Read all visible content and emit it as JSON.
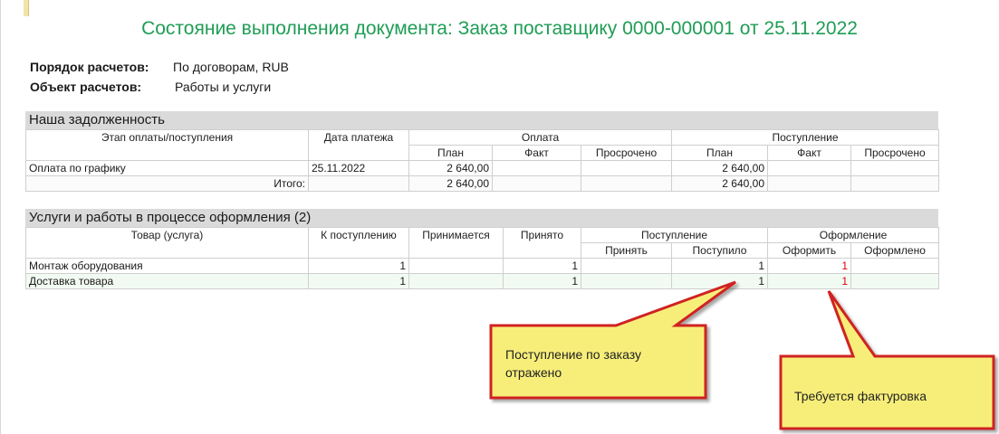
{
  "title": "Состояние выполнения документа: Заказ поставщику 0000-000001 от 25.11.2022",
  "info": [
    {
      "label": "Порядок расчетов:",
      "value": "По договорам, RUB"
    },
    {
      "label": "Объект расчетов:",
      "value": "Работы и услуги"
    }
  ],
  "debt_section": {
    "title": "Наша задолженность",
    "headers": {
      "stage": "Этап оплаты/поступления",
      "date": "Дата платежа",
      "payment": "Оплата",
      "receipt": "Поступление",
      "plan": "План",
      "fact": "Факт",
      "overdue": "Просрочено"
    },
    "rows": [
      {
        "stage": "Оплата по графику",
        "date": "25.11.2022",
        "pay_plan": "2 640,00",
        "pay_fact": "",
        "pay_overdue": "",
        "rec_plan": "2 640,00",
        "rec_fact": "",
        "rec_overdue": ""
      }
    ],
    "total": {
      "label": "Итого:",
      "pay_plan": "2 640,00",
      "rec_plan": "2 640,00"
    }
  },
  "services_section": {
    "title": "Услуги и работы в процессе оформления (2)",
    "headers": {
      "product": "Товар (услуга)",
      "to_receive": "К поступлению",
      "being_accepted": "Принимается",
      "accepted": "Принято",
      "receipt": "Поступление",
      "accept": "Принять",
      "received": "Поступило",
      "registration": "Оформление",
      "to_register": "Оформить",
      "registered": "Оформлено"
    },
    "rows": [
      {
        "product": "Монтаж оборудования",
        "to_receive": "1",
        "being_accepted": "",
        "accepted": "1",
        "accept": "",
        "received": "1",
        "to_register": "1",
        "registered": ""
      },
      {
        "product": "Доставка товара",
        "to_receive": "1",
        "being_accepted": "",
        "accepted": "1",
        "accept": "",
        "received": "1",
        "to_register": "1",
        "registered": ""
      }
    ]
  },
  "callouts": [
    {
      "text": "Поступление по заказу отражено"
    },
    {
      "text": "Требуется фактуровка"
    }
  ],
  "colors": {
    "title": "#1f9d55",
    "red_value": "#e00000",
    "callout_fill": "#f7ee7a",
    "callout_border": "#d02020"
  }
}
